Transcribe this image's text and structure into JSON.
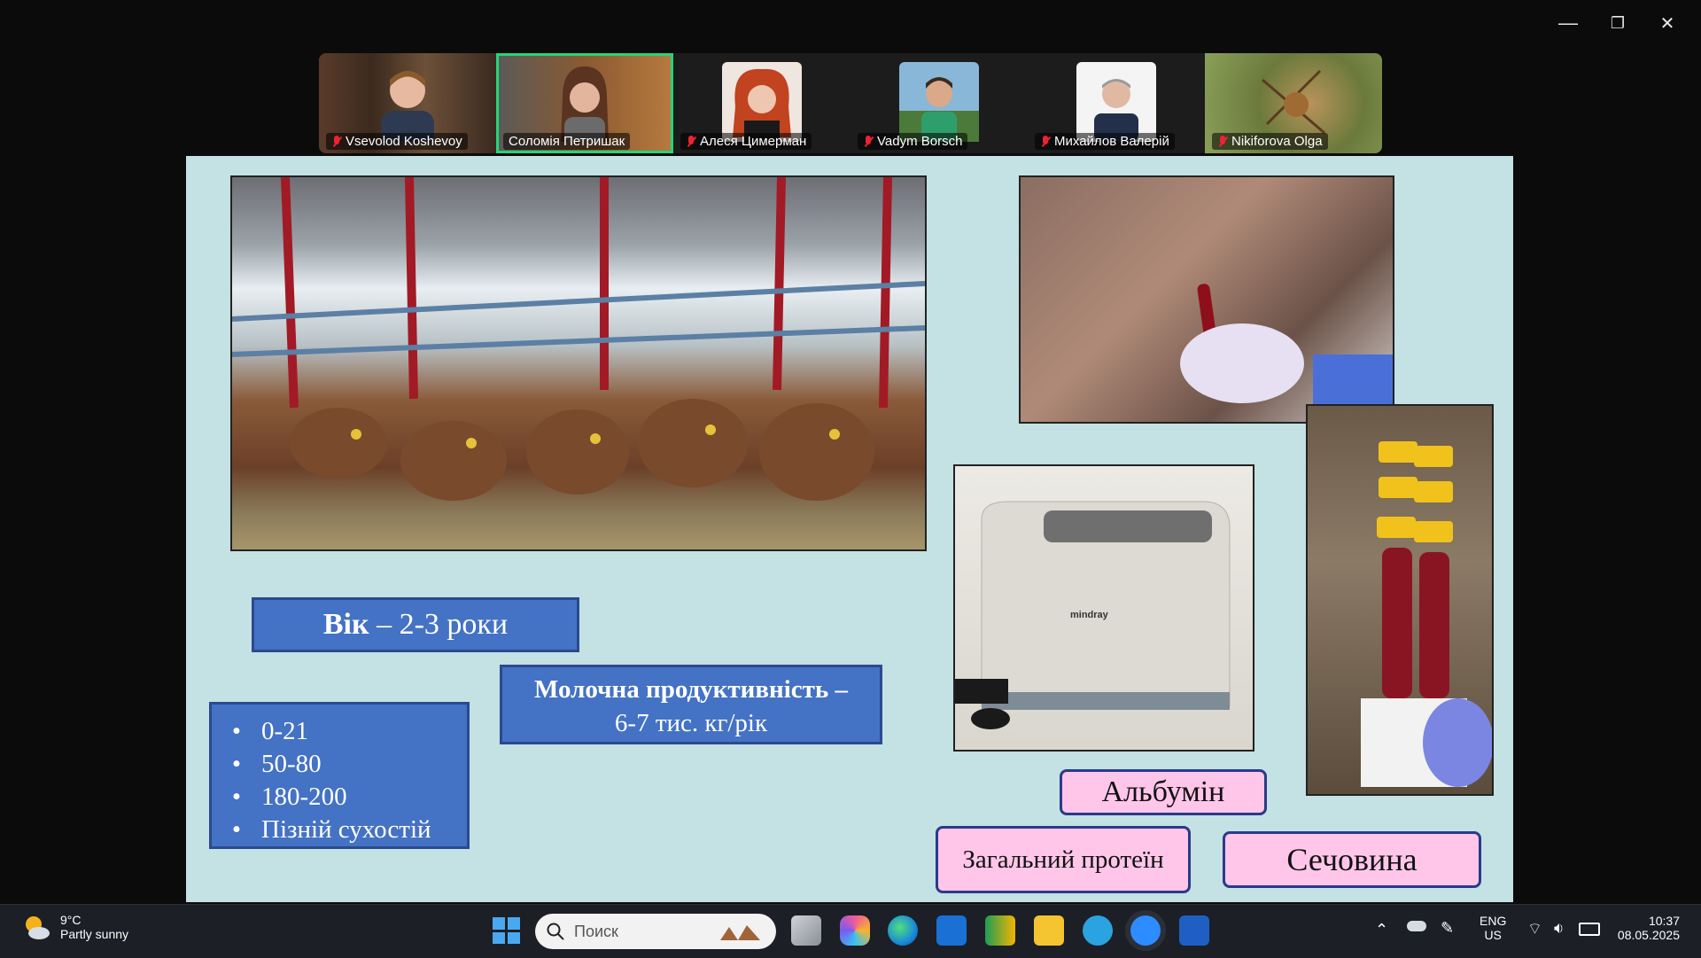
{
  "window": {
    "min": "—",
    "restore": "❐",
    "close": "✕"
  },
  "participants": [
    {
      "name": "Vsevolod Koshevoy",
      "muted": true,
      "active": false
    },
    {
      "name": "Соломія Петришак",
      "muted": false,
      "active": true
    },
    {
      "name": "Алеся Цимерман",
      "muted": true,
      "active": false
    },
    {
      "name": "Vadym Borsch",
      "muted": true,
      "active": false
    },
    {
      "name": "Михайлов Валерій",
      "muted": true,
      "active": false
    },
    {
      "name": "Nikiforova Olga",
      "muted": true,
      "active": false
    }
  ],
  "slide": {
    "age_bold": "Вік",
    "age_rest": " – 2-3 роки",
    "milk_line1": "Молочна продуктивність –",
    "milk_line2": "6-7 тис. кг/рік",
    "list": [
      "0-21",
      "50-80",
      "180-200",
      "Пізній сухостій"
    ],
    "albumin": "Альбумін",
    "protein": "Загальний протеїн",
    "urea": "Сечовина",
    "analyzer_brand": "mindray"
  },
  "taskbar": {
    "weather_temp": "9°C",
    "weather_desc": "Partly sunny",
    "search_placeholder": "Поиск",
    "lang1": "ENG",
    "lang2": "US",
    "time": "10:37",
    "date": "08.05.2025"
  }
}
